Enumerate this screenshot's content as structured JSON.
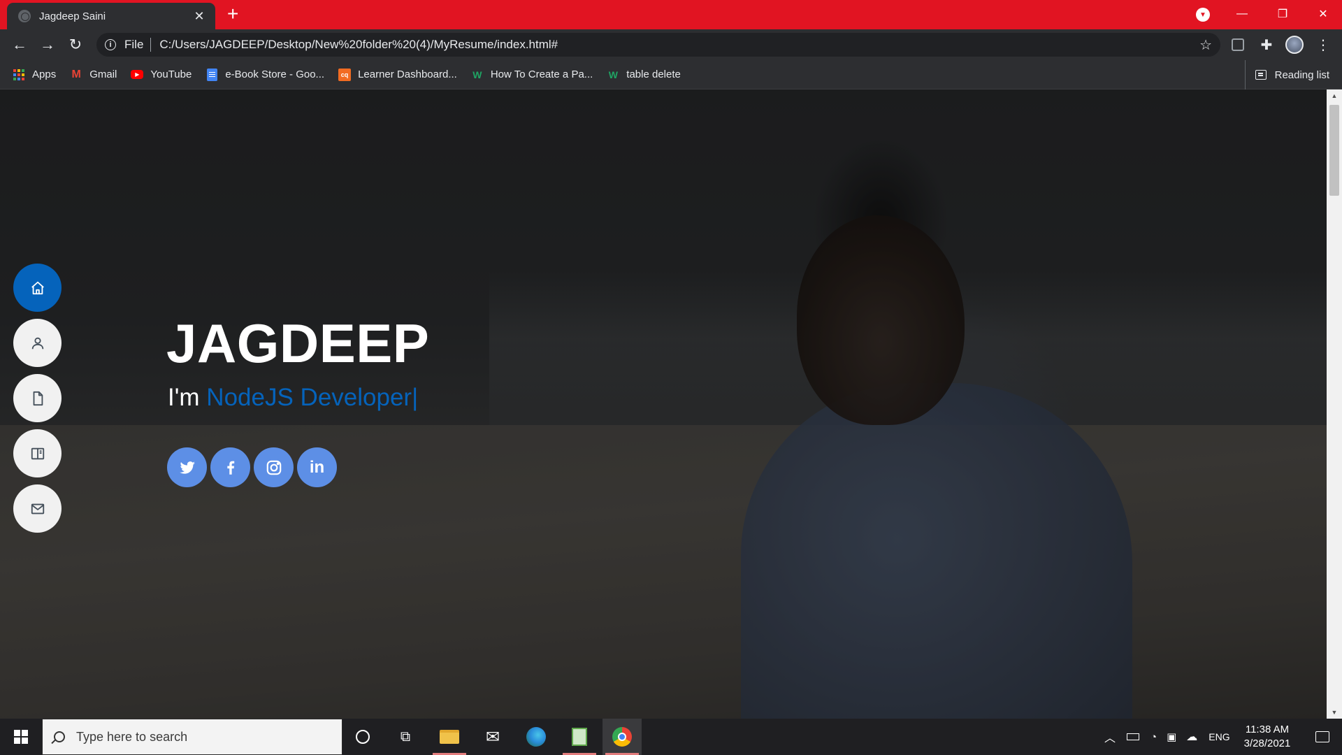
{
  "browser": {
    "tab_title": "Jagdeep Saini",
    "new_tab_symbol": "+",
    "address": {
      "scheme_label": "File",
      "url": "C:/Users/JAGDEEP/Desktop/New%20folder%20(4)/MyResume/index.html#"
    },
    "bookmarks": [
      {
        "label": "Apps",
        "icon": "apps-grid-icon"
      },
      {
        "label": "Gmail",
        "icon": "gmail-icon"
      },
      {
        "label": "YouTube",
        "icon": "youtube-icon"
      },
      {
        "label": "e-Book Store - Goo...",
        "icon": "docs-icon"
      },
      {
        "label": "Learner Dashboard...",
        "icon": "cq-icon"
      },
      {
        "label": "How To Create a Pa...",
        "icon": "w-icon"
      },
      {
        "label": "table delete",
        "icon": "w-icon"
      }
    ],
    "reading_list": "Reading list",
    "colors": {
      "frame": "#e11422",
      "toolbar": "#2d2e31"
    }
  },
  "page": {
    "name": "JAGDEEP",
    "subtitle_prefix": "I'm",
    "role": "NodeJS Developer|",
    "accent": "#0563bb",
    "social_color": "#5d8fe6",
    "side_nav": [
      {
        "icon": "home-icon",
        "active": true
      },
      {
        "icon": "person-icon",
        "active": false
      },
      {
        "icon": "file-icon",
        "active": false
      },
      {
        "icon": "book-icon",
        "active": false
      },
      {
        "icon": "mail-icon",
        "active": false
      }
    ],
    "socials": [
      {
        "icon": "twitter-icon"
      },
      {
        "icon": "facebook-icon"
      },
      {
        "icon": "instagram-icon"
      },
      {
        "icon": "linkedin-icon",
        "text": "in"
      }
    ]
  },
  "taskbar": {
    "search_placeholder": "Type here to search",
    "language": "ENG",
    "time": "11:38 AM",
    "date": "3/28/2021"
  }
}
